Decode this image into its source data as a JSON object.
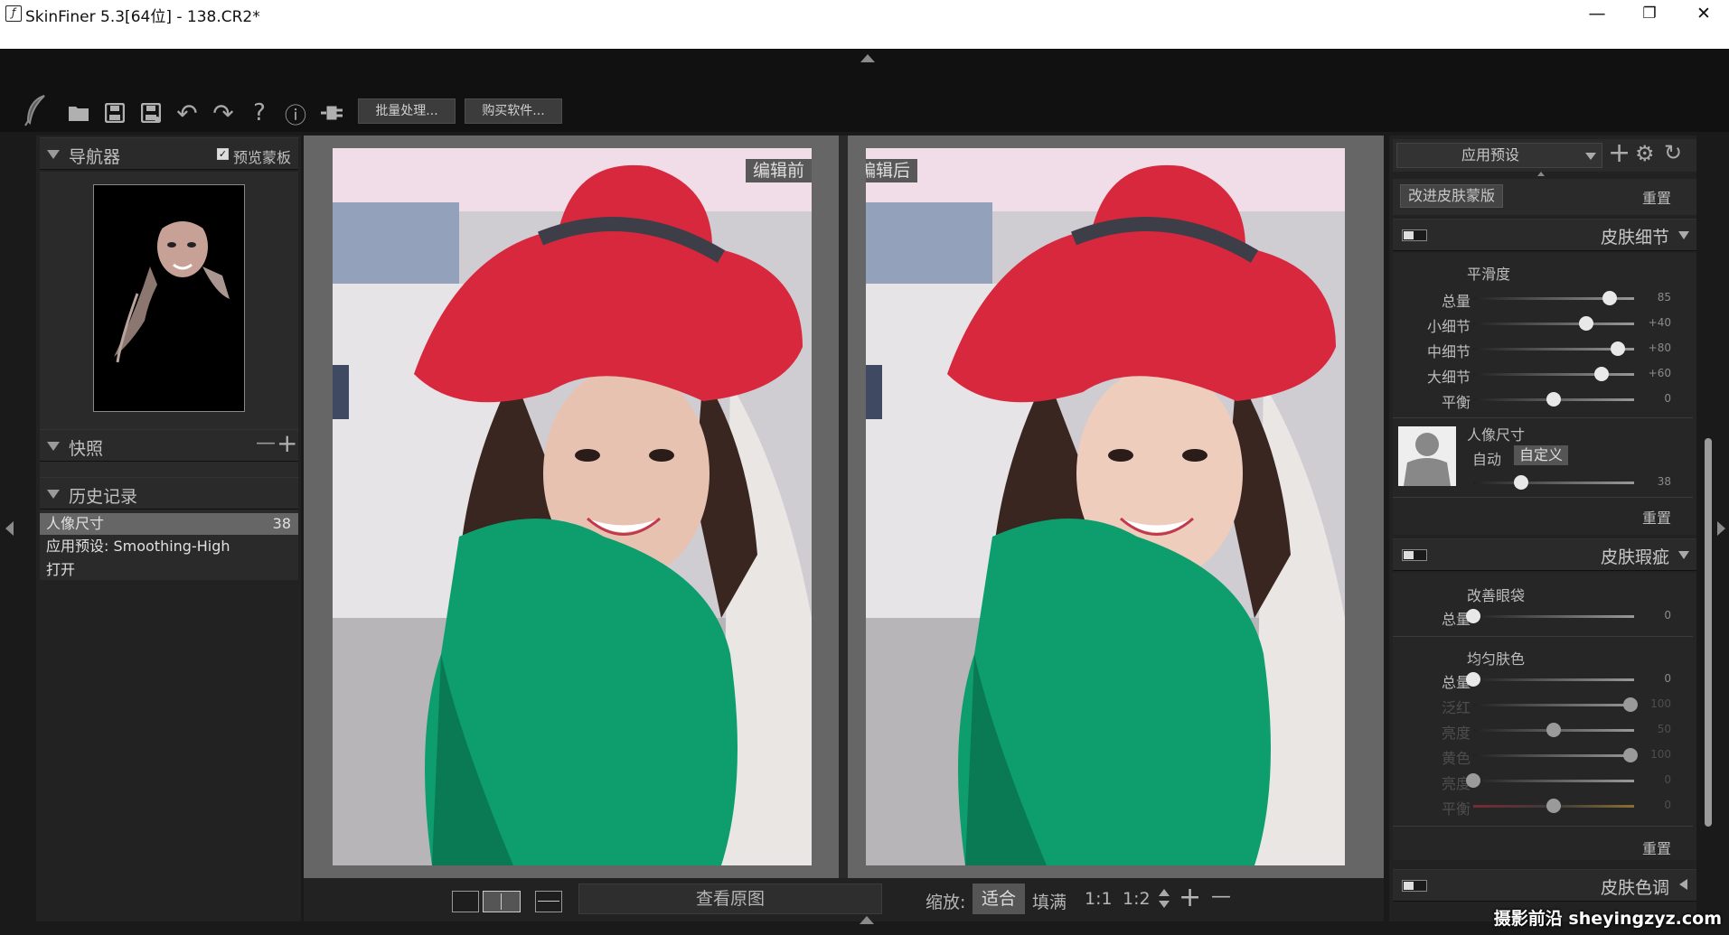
{
  "window": {
    "title": "SkinFiner 5.3[64位] - 138.CR2*",
    "minimize_glyph": "—",
    "restore_glyph": "❐",
    "close_glyph": "✕"
  },
  "toolbar": {
    "icons": [
      "feather-logo-icon",
      "open-folder-icon",
      "save-icon",
      "save-as-icon",
      "undo-icon",
      "redo-icon",
      "help-icon",
      "info-icon",
      "plugin-icon"
    ],
    "help_glyph": "?",
    "info_glyph": "ⓘ",
    "undo_glyph": "↶",
    "redo_glyph": "↷",
    "batch_label": "批量处理...",
    "buy_label": "购买软件..."
  },
  "navigator": {
    "title": "导航器",
    "preview_mask_label": "预览蒙板",
    "preview_mask_checked": true
  },
  "snapshots": {
    "title": "快照",
    "remove_glyph": "—",
    "add_glyph": "+"
  },
  "history": {
    "title": "历史记录",
    "items": [
      {
        "label": "人像尺寸",
        "value": "38",
        "selected": true
      },
      {
        "label": "应用预设: Smoothing-High",
        "value": "",
        "selected": false
      },
      {
        "label": "打开",
        "value": "",
        "selected": false
      }
    ]
  },
  "canvas": {
    "before_label": "编辑前",
    "after_label": "编辑后"
  },
  "bottom": {
    "view_original_label": "查看原图",
    "zoom_label": "缩放:",
    "fit_label": "适合",
    "fill_label": "填满",
    "zoom_1_1": "1:1",
    "zoom_1_2": "1:2",
    "zoom_in_glyph": "+",
    "zoom_out_glyph": "—"
  },
  "presets": {
    "select_value": "应用预设",
    "improve_mask_label": "改进皮肤蒙版",
    "reset_label": "重置"
  },
  "skin_detail": {
    "title": "皮肤细节",
    "smoothness_label": "平滑度",
    "sliders": [
      {
        "label": "总量",
        "value": "85",
        "fraction": 0.85
      },
      {
        "label": "小细节",
        "value": "+40",
        "fraction": 0.7
      },
      {
        "label": "中细节",
        "value": "+80",
        "fraction": 0.9
      },
      {
        "label": "大细节",
        "value": "+60",
        "fraction": 0.8
      },
      {
        "label": "平衡",
        "value": "0",
        "fraction": 0.5
      }
    ],
    "portrait_size_label": "人像尺寸",
    "auto_label": "自动",
    "custom_label": "自定义",
    "portrait_size_value": "38",
    "portrait_size_fraction": 0.3,
    "reset_label": "重置"
  },
  "skin_blemish": {
    "title": "皮肤瑕疵",
    "eye_bags_label": "改善眼袋",
    "eye_bags_amount_label": "总量",
    "eye_bags_amount_value": "0",
    "even_tone_label": "均匀肤色",
    "tone_sliders": [
      {
        "label": "总量",
        "value": "0",
        "fraction": 0.0,
        "dim": false
      },
      {
        "label": "泛红",
        "value": "100",
        "fraction": 0.98,
        "dim": true
      },
      {
        "label": "亮度",
        "value": "50",
        "fraction": 0.5,
        "dim": true
      },
      {
        "label": "黄色",
        "value": "100",
        "fraction": 0.98,
        "dim": true
      },
      {
        "label": "亮度",
        "value": "0",
        "fraction": 0.0,
        "dim": true
      },
      {
        "label": "平衡",
        "value": "0",
        "fraction": 0.5,
        "dim": true
      }
    ],
    "reset_label": "重置"
  },
  "skin_tone": {
    "title": "皮肤色调"
  },
  "watermark": "摄影前沿 sheyingzyz.com"
}
